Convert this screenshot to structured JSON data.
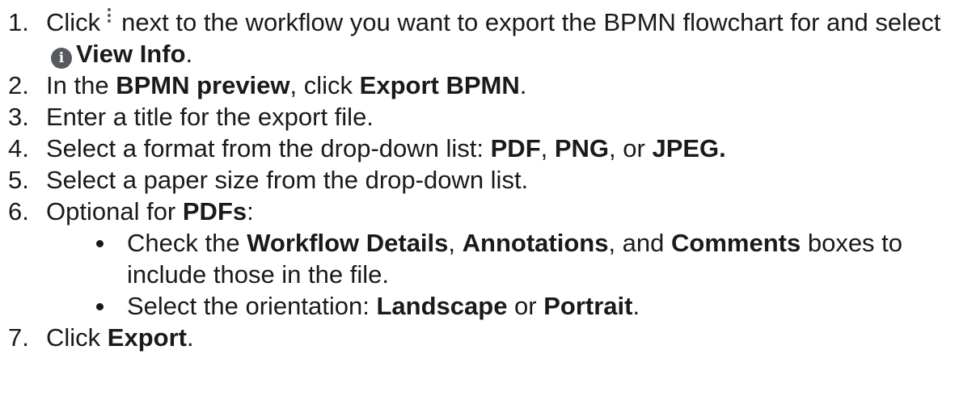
{
  "icons": {
    "kebab": "vertical-ellipsis-icon",
    "info": "info-circle-icon",
    "info_glyph": "i"
  },
  "steps": [
    {
      "num": "1.",
      "parts": [
        "Click",
        "next to the workflow you want to export the BPMN flowchart for and select",
        "View Info",
        "."
      ]
    },
    {
      "num": "2.",
      "parts": [
        "In the ",
        "BPMN preview",
        ", click ",
        "Export BPMN",
        "."
      ]
    },
    {
      "num": "3.",
      "parts": [
        "Enter a title for the export file."
      ]
    },
    {
      "num": "4.",
      "parts": [
        "Select a format from the drop-down list: ",
        "PDF",
        ", ",
        "PNG",
        ", or ",
        "JPEG."
      ]
    },
    {
      "num": "5.",
      "parts": [
        "Select a paper size from the drop-down list."
      ]
    },
    {
      "num": "6.",
      "parts": [
        "Optional for ",
        "PDFs",
        ":"
      ],
      "sub": [
        {
          "parts": [
            "Check the ",
            "Workflow Details",
            ", ",
            "Annotations",
            ", and ",
            "Comments",
            " boxes to include those in the file."
          ]
        },
        {
          "parts": [
            "Select the orientation: ",
            "Landscape",
            " or ",
            "Portrait",
            "."
          ]
        }
      ]
    },
    {
      "num": "7.",
      "parts": [
        "Click ",
        "Export",
        "."
      ]
    }
  ]
}
